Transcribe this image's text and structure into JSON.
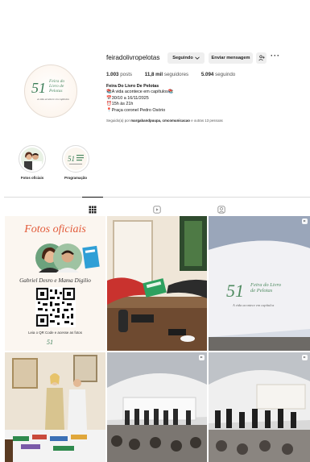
{
  "profile": {
    "username": "feiradolivropelotas",
    "following_button": "Seguindo",
    "message_button": "Enviar mensagem",
    "more_label": "···",
    "logo": {
      "number": "51",
      "title": "Feira do Livro de Pelotas",
      "tagline": "A vida acontece em capítulos"
    }
  },
  "stats": {
    "posts_count": "1.003",
    "posts_label": "posts",
    "followers_count": "11,8 mil",
    "followers_label": "seguidores",
    "following_count": "5.094",
    "following_label": "seguindo"
  },
  "bio": {
    "name": "Feira Do Livro De Pelotas",
    "line1": "📚A vida acontece em capítulos📚",
    "line2": "📅30/10 a 16/11/2025",
    "line3": "⏰15h às 21h",
    "line4": "📍Praça coronel Pedro Osório"
  },
  "followed_by": {
    "prefix": "Seguido(a) por",
    "names": "margabandpuupa, cmcomunicacao",
    "suffix": "e outras 13 pessoas"
  },
  "highlights": [
    {
      "label": "Fotos oficiais"
    },
    {
      "label": "Programação"
    }
  ],
  "post1": {
    "title": "Fotos oficiais",
    "names": "Gabriel Desro e Mama Digilio",
    "cta": "Leia o QR Code e acesse as fotos",
    "logo_number": "51"
  },
  "post3": {
    "number": "51",
    "title": "Feira do Livro de Pelotas",
    "tagline": "A vida acontece em capítulos"
  },
  "colors": {
    "accent": "#3a7d57",
    "button_bg": "#efefef",
    "divider": "#dbdbdb",
    "post1_title": "#e25b3a"
  }
}
